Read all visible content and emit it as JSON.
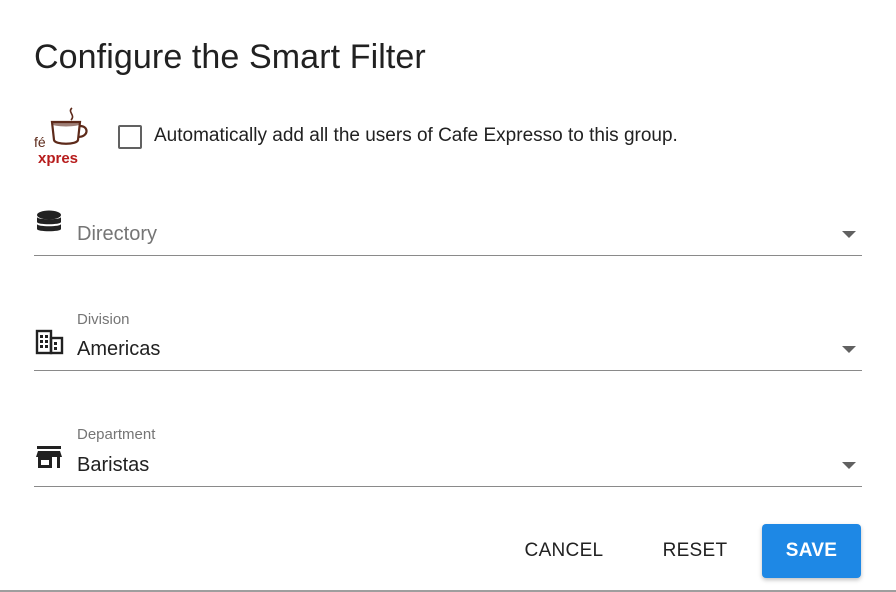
{
  "dialog": {
    "title": "Configure the Smart Filter"
  },
  "auto_add": {
    "label": "Automatically add all the users of Cafe Expresso to this group.",
    "checked": false,
    "logo_icon": "cafe-expresso-logo"
  },
  "fields": {
    "directory": {
      "placeholder": "Directory",
      "icon": "database-icon"
    },
    "division": {
      "label": "Division",
      "value": "Americas",
      "icon": "building-icon"
    },
    "department": {
      "label": "Department",
      "value": "Baristas",
      "icon": "store-icon"
    }
  },
  "actions": {
    "cancel": "CANCEL",
    "reset": "RESET",
    "save": "SAVE"
  },
  "colors": {
    "primary": "#1e88e5",
    "logo_red": "#b71c1c",
    "logo_brown": "#5d2a1a"
  }
}
